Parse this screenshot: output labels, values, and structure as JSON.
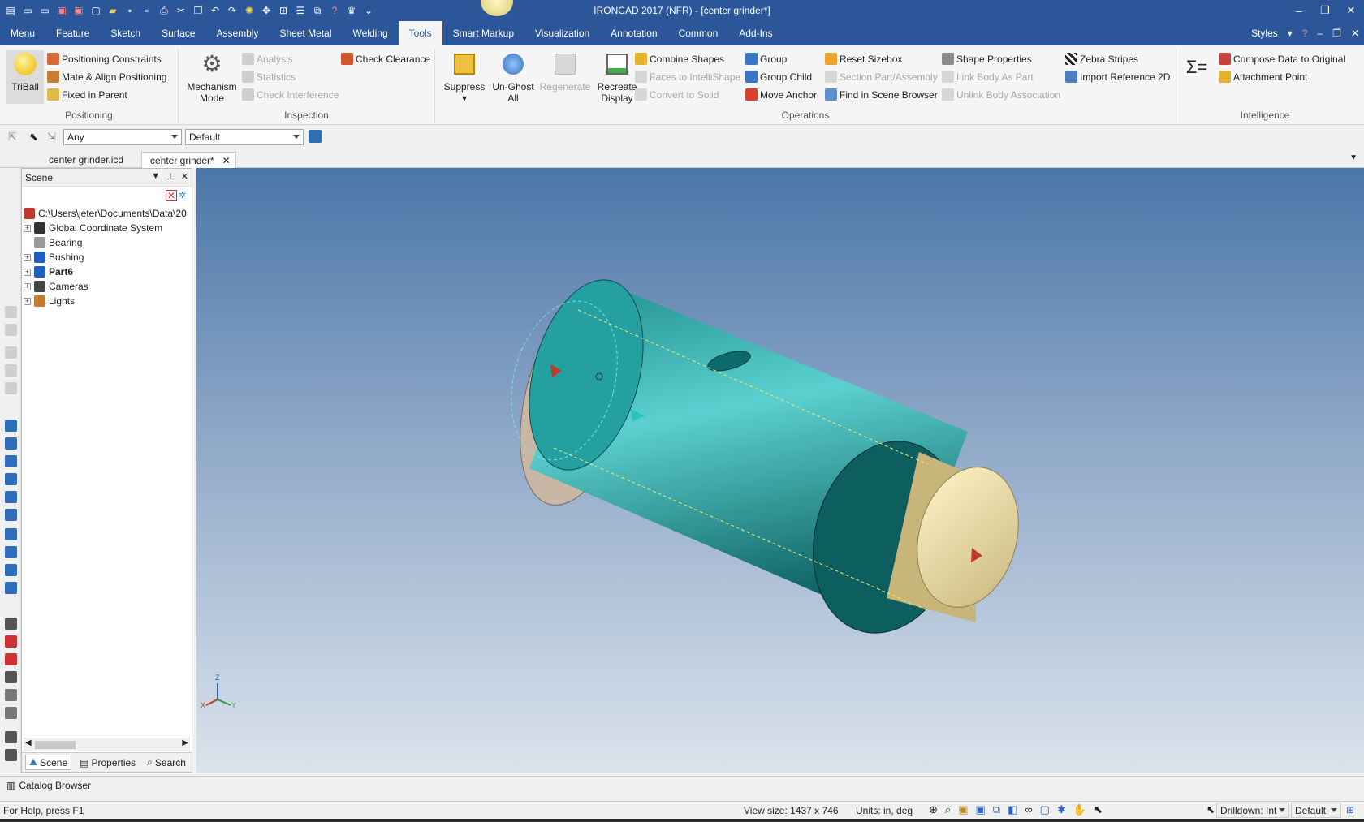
{
  "window": {
    "title": "IRONCAD 2017 (NFR) - [center grinder*]",
    "controls": [
      "–",
      "❐",
      "✕"
    ]
  },
  "menu": {
    "tabs": [
      "Menu",
      "Feature",
      "Sketch",
      "Surface",
      "Assembly",
      "Sheet Metal",
      "Welding",
      "Tools",
      "Smart Markup",
      "Visualization",
      "Annotation",
      "Common",
      "Add-Ins"
    ],
    "active_tab": "Tools",
    "styles_label": "Styles"
  },
  "ribbon": {
    "positioning": {
      "label": "Positioning",
      "triball": "TriBall",
      "positioning_constraints": "Positioning Constraints",
      "mate_align": "Mate & Align Positioning",
      "fixed_in_parent": "Fixed in Parent"
    },
    "inspection": {
      "label": "Inspection",
      "mechanism_mode_1": "Mechanism",
      "mechanism_mode_2": "Mode",
      "analysis": "Analysis",
      "statistics": "Statistics",
      "check_interference": "Check Interference",
      "check_clearance": "Check Clearance"
    },
    "operations": {
      "label": "Operations",
      "suppress": "Suppress",
      "unghost_1": "Un-Ghost",
      "unghost_2": "All",
      "regenerate": "Regenerate",
      "recreate_1": "Recreate",
      "recreate_2": "Display",
      "combine_shapes": "Combine Shapes",
      "faces_to_intellishape": "Faces to IntelliShape",
      "convert_to_solid": "Convert to Solid",
      "group": "Group",
      "group_child": "Group Child",
      "move_anchor": "Move Anchor",
      "reset_sizebox": "Reset Sizebox",
      "section_part": "Section Part/Assembly",
      "find_in_scene": "Find in Scene Browser",
      "shape_properties": "Shape Properties",
      "link_body_as_part": "Link Body As Part",
      "unlink_body": "Unlink Body Association",
      "zebra_stripes": "Zebra Stripes",
      "import_reference_2d": "Import Reference 2D"
    },
    "intelligence": {
      "label": "Intelligence",
      "compose_data": "Compose Data to Original",
      "attachment_point": "Attachment Point"
    }
  },
  "selection_toolbar": {
    "filter_value": "Any",
    "style_value": "Default"
  },
  "doc_tabs": [
    "center grinder.icd",
    "center grinder*"
  ],
  "active_doc_tab": "center grinder*",
  "scene_panel": {
    "title": "Scene",
    "tree": [
      {
        "label": "C:\\Users\\jeter\\Documents\\Data\\20",
        "expandable": false,
        "bold": false,
        "color": "#c0392b"
      },
      {
        "label": "Global Coordinate System",
        "expandable": true,
        "bold": false,
        "color": "#333333"
      },
      {
        "label": "Bearing",
        "expandable": false,
        "bold": false,
        "color": "#9a9a9a"
      },
      {
        "label": "Bushing",
        "expandable": true,
        "bold": false,
        "color": "#1f5fbf"
      },
      {
        "label": "Part6",
        "expandable": true,
        "bold": true,
        "color": "#1f5fbf"
      },
      {
        "label": "Cameras",
        "expandable": true,
        "bold": false,
        "color": "#444444"
      },
      {
        "label": "Lights",
        "expandable": true,
        "bold": false,
        "color": "#c47b2b"
      }
    ],
    "bottom_tabs": [
      "Scene",
      "Properties",
      "Search"
    ]
  },
  "axes": {
    "x": "X",
    "y": "Y",
    "z": "Z"
  },
  "catalog_browser": "Catalog Browser",
  "status_bar": {
    "help": "For Help, press F1",
    "view_size": "View size: 1437 x 746",
    "units": "Units: in, deg",
    "drilldown": "Drilldown: Int",
    "style": "Default"
  },
  "colors": {
    "title_bar": "#2b579a",
    "shaft": "#1e8b8b",
    "flange": "#c9b7a6",
    "bushing": "#e6dcaa"
  }
}
